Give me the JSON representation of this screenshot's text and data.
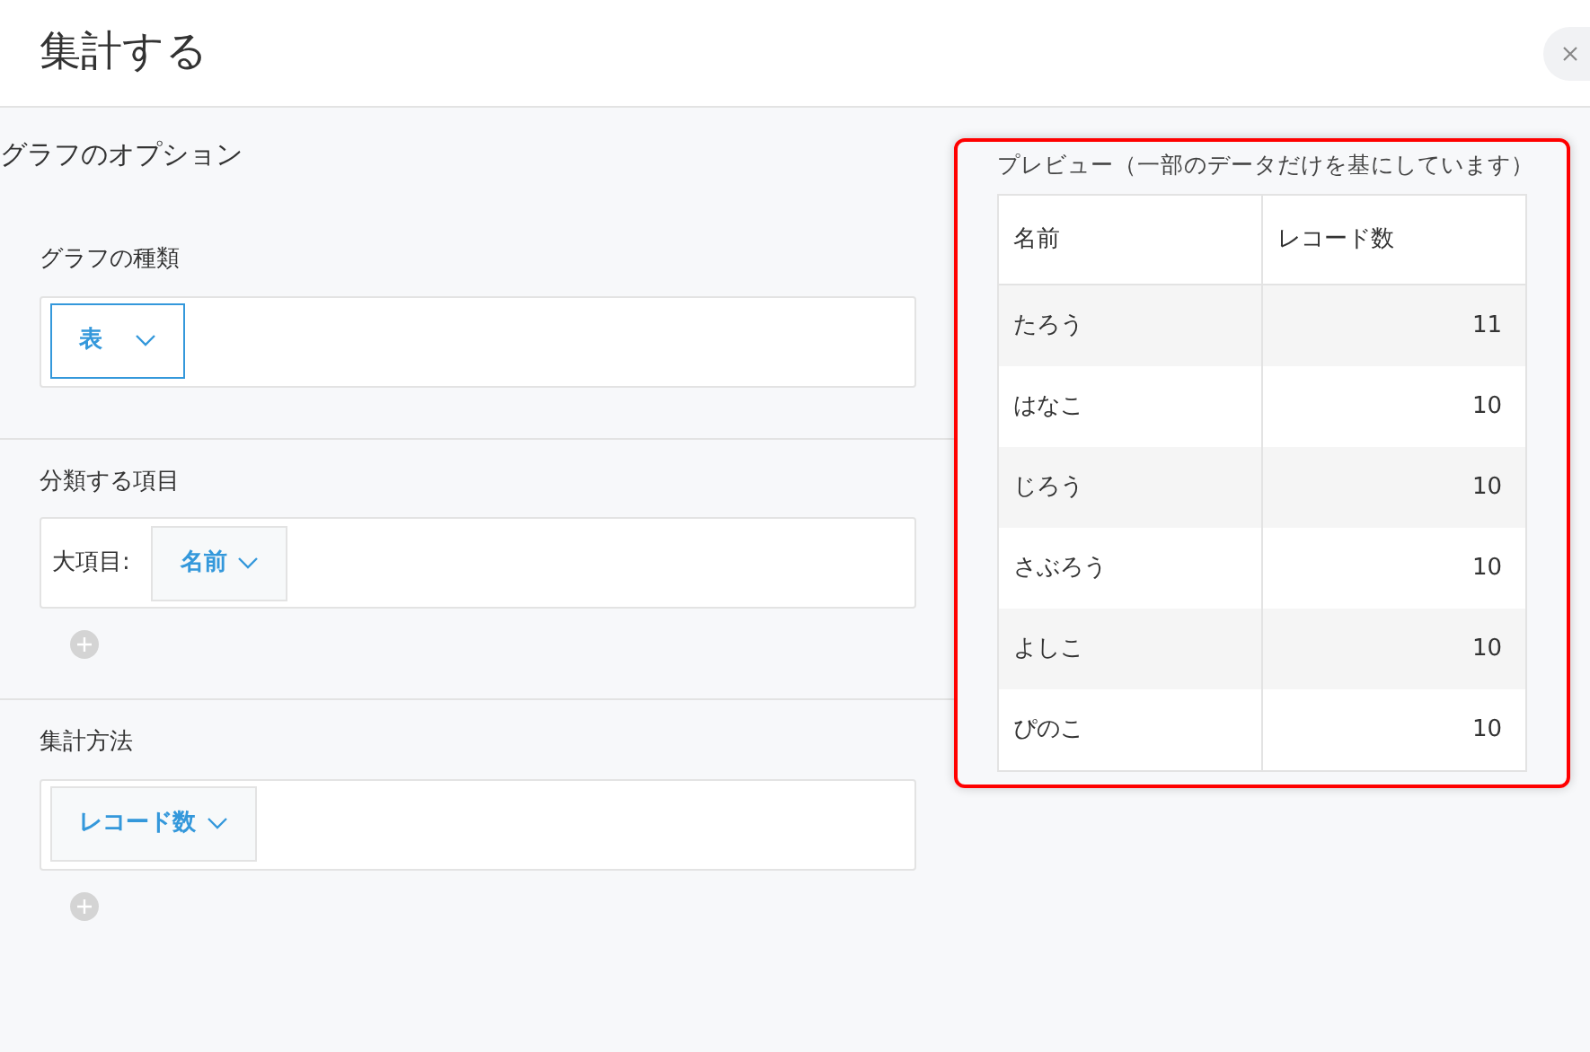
{
  "dialog": {
    "title": "集計する"
  },
  "options": {
    "heading": "グラフのオプション",
    "sections": [
      {
        "label": "グラフの種類",
        "select": {
          "value": "表",
          "focused": true
        }
      },
      {
        "label": "分類する項目",
        "field_label": "大項目:",
        "select": {
          "value": "名前",
          "focused": false
        },
        "add": true
      },
      {
        "label": "集計方法",
        "select": {
          "value": "レコード数",
          "focused": false
        },
        "add": true
      }
    ]
  },
  "preview": {
    "title": "プレビュー（一部のデータだけを基にしています）",
    "highlighted": true,
    "columns": [
      "名前",
      "レコード数"
    ],
    "rows": [
      [
        "たろう",
        "11"
      ],
      [
        "はなこ",
        "10"
      ],
      [
        "じろう",
        "10"
      ],
      [
        "さぶろう",
        "10"
      ],
      [
        "よしこ",
        "10"
      ],
      [
        "ぴのこ",
        "10"
      ]
    ]
  }
}
